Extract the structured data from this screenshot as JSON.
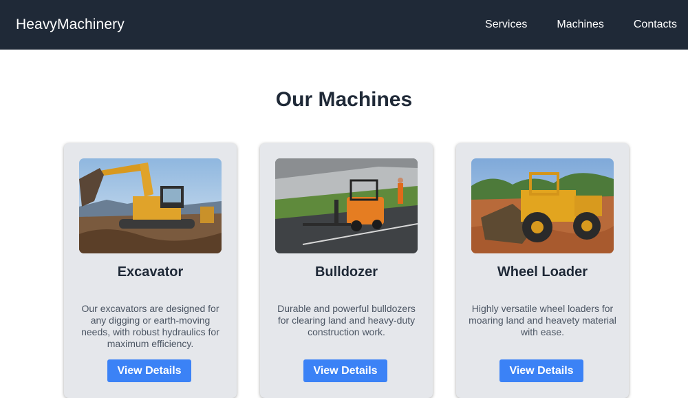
{
  "nav": {
    "brand": "HeavyMachinery",
    "links": [
      "Services",
      "Machines",
      "Contacts"
    ]
  },
  "main": {
    "title": "Our Machines",
    "cards": [
      {
        "title": "Excavator",
        "description": "Our excavators are designed for any digging or earth-moving needs, with robust hydraulics for maximum efficiency.",
        "button_label": "View Details"
      },
      {
        "title": "Bulldozer",
        "description": "Durable and powerful bulldozers for clearing land and heavy-duty construction work.",
        "button_label": "View Details"
      },
      {
        "title": "Wheel Loader",
        "description": "Highly versatile wheel loaders for moaring land and heavety material with ease.",
        "button_label": "View Details"
      }
    ]
  },
  "colors": {
    "navbar": "#1f2937",
    "button": "#3b82f6",
    "card": "#e5e7eb"
  }
}
